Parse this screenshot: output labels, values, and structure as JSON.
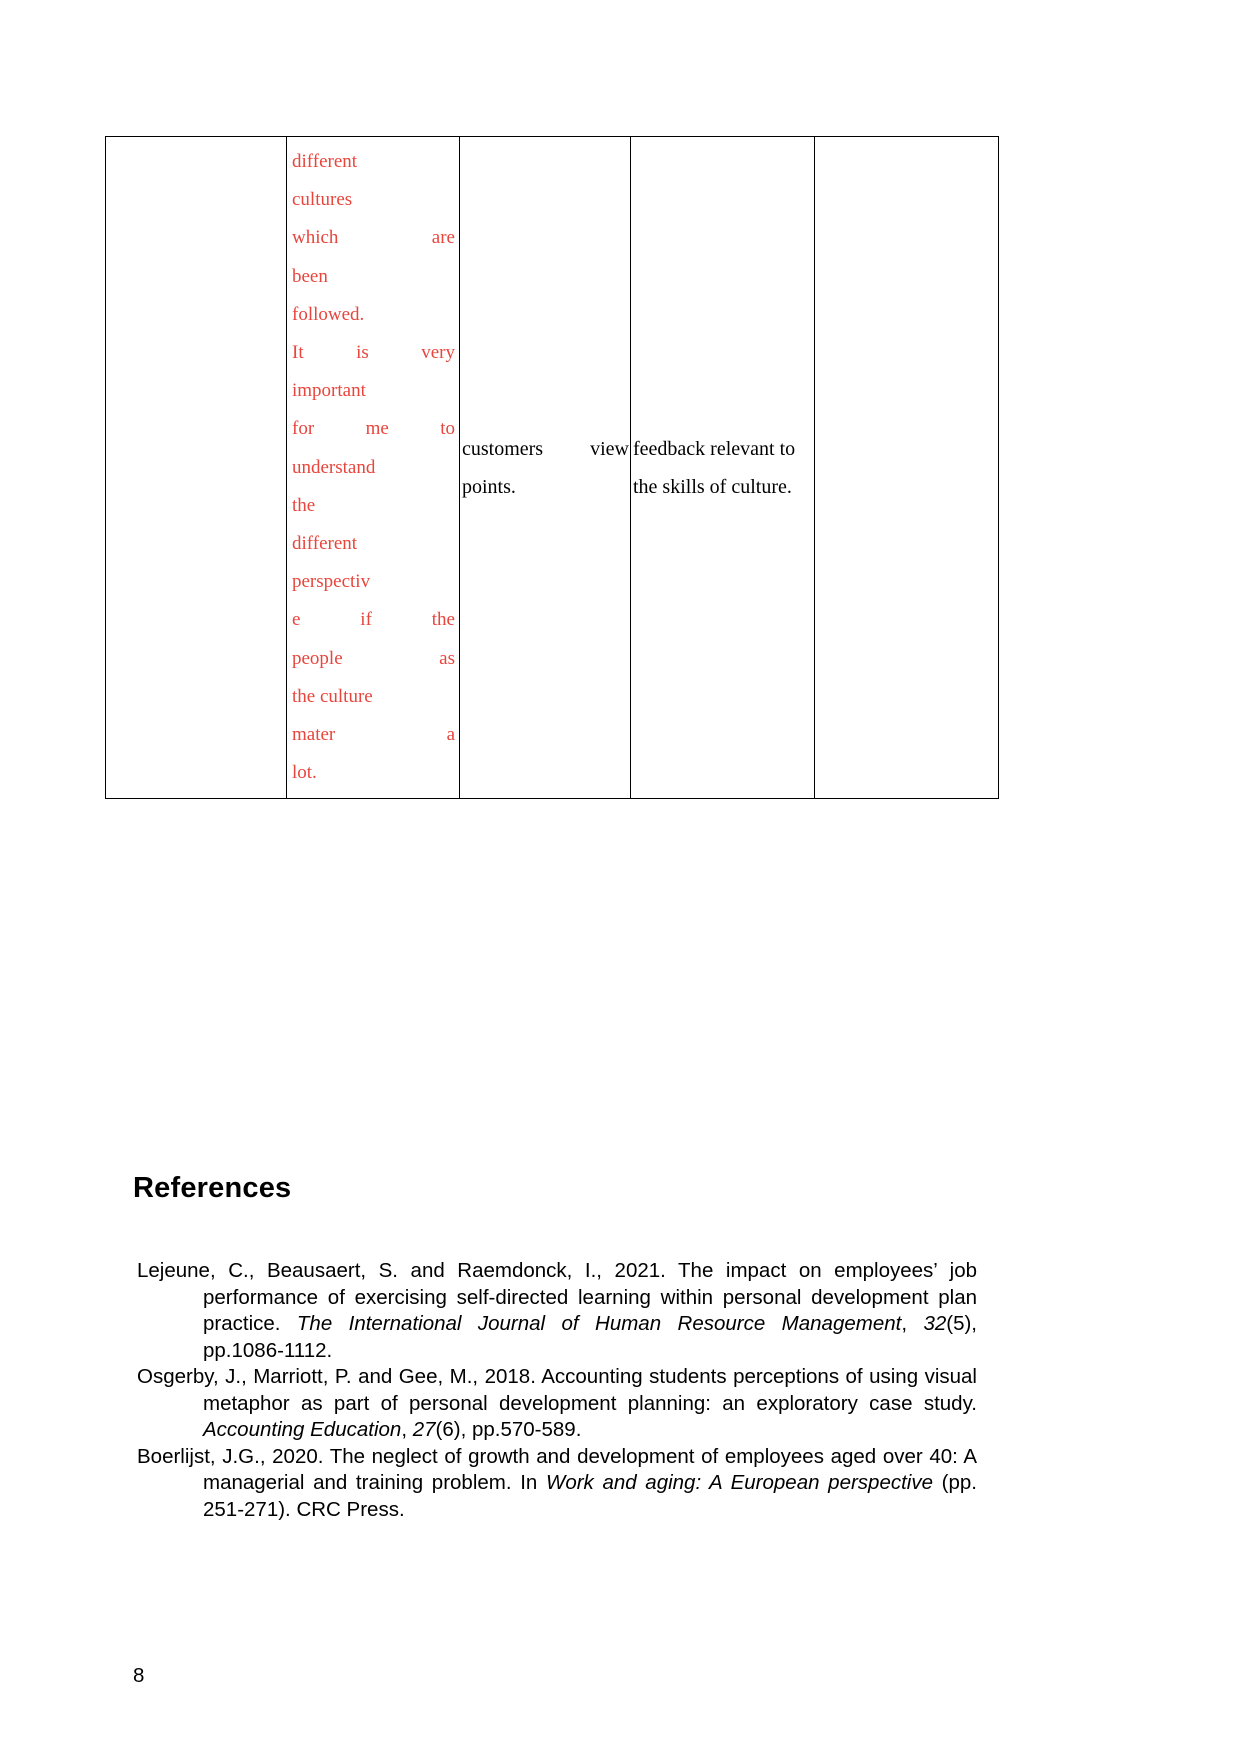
{
  "document": {
    "page_number": "8"
  },
  "table": {
    "columns": [
      "",
      "",
      "",
      "",
      ""
    ],
    "row": {
      "cell_1": "",
      "cell_2_lines": [
        "different",
        "cultures",
        "which are",
        "been",
        "followed.",
        "It is very",
        "important",
        "for me to",
        "understand",
        "the",
        "different",
        "perspectiv",
        "e if the",
        "people as",
        "the culture",
        "mater a",
        "lot."
      ],
      "cell_2_justified_flags": [
        false,
        false,
        true,
        false,
        false,
        true,
        false,
        true,
        false,
        false,
        false,
        false,
        true,
        true,
        false,
        true,
        false
      ],
      "cell_3_lines": [
        "customers view",
        "points."
      ],
      "cell_3_justified_flags": [
        true,
        false
      ],
      "cell_4_lines": [
        "feedback relevant to",
        "the skills of culture."
      ],
      "cell_4_justified_flags": [
        false,
        false
      ],
      "cell_5": ""
    }
  },
  "references": {
    "heading": "References",
    "entries": [
      {
        "parts": [
          {
            "text": "Lejeune, C., Beausaert, S. and Raemdonck, I., 2021. The impact on employees’ job performance of exercising self-directed learning within personal development plan practice. ",
            "italic": false
          },
          {
            "text": "The International Journal of Human Resource Management",
            "italic": true
          },
          {
            "text": ", ",
            "italic": false
          },
          {
            "text": "32",
            "italic": true
          },
          {
            "text": "(5), pp.1086-1112.",
            "italic": false
          }
        ]
      },
      {
        "parts": [
          {
            "text": "Osgerby, J., Marriott, P. and Gee, M., 2018. Accounting students perceptions of using visual metaphor as part of personal development planning: an exploratory case study. ",
            "italic": false
          },
          {
            "text": "Accounting Education",
            "italic": true
          },
          {
            "text": ", ",
            "italic": false
          },
          {
            "text": "27",
            "italic": true
          },
          {
            "text": "(6), pp.570-589.",
            "italic": false
          }
        ]
      },
      {
        "parts": [
          {
            "text": "Boerlijst, J.G., 2020. The neglect of growth and development of employees aged over 40: A managerial and training problem. In ",
            "italic": false
          },
          {
            "text": "Work and aging: A European perspective",
            "italic": true
          },
          {
            "text": " (pp. 251-271). CRC Press.",
            "italic": false
          }
        ]
      }
    ]
  },
  "colors": {
    "red_text": "#e8453c",
    "body_text": "#000000",
    "border": "#000000",
    "background": "#ffffff"
  }
}
